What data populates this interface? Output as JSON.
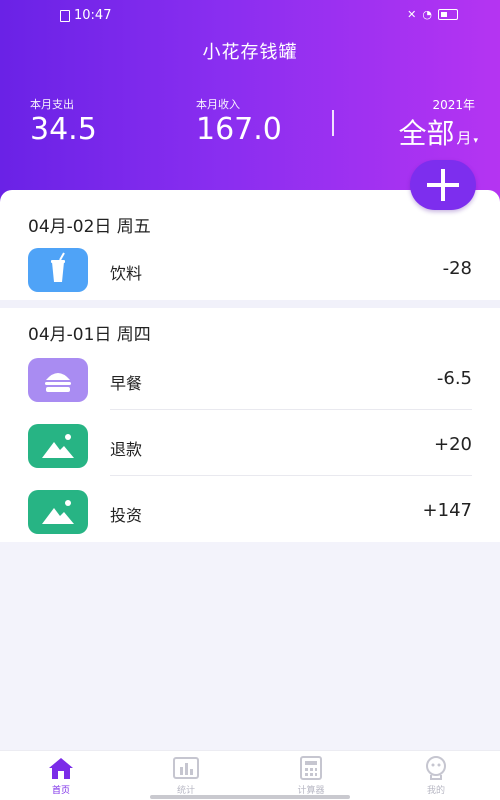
{
  "status_bar": {
    "time": "10:47"
  },
  "app": {
    "title": "小花存钱罐"
  },
  "summary": {
    "expense_label": "本月支出",
    "expense_value": "34.5",
    "income_label": "本月收入",
    "income_value": "167.0",
    "year": "2021年",
    "month_value": "全部",
    "month_suffix": "月",
    "caret": "▾"
  },
  "groups": [
    {
      "date": "04月-02日 周五",
      "transactions": [
        {
          "name": "饮料",
          "amount": "-28",
          "icon": "drink-icon"
        }
      ]
    },
    {
      "date": "04月-01日 周四",
      "transactions": [
        {
          "name": "早餐",
          "amount": "-6.5",
          "icon": "burger-icon"
        },
        {
          "name": "退款",
          "amount": "+20",
          "icon": "mountain-image-icon"
        },
        {
          "name": "投资",
          "amount": "+147",
          "icon": "mountain-image-icon"
        }
      ]
    }
  ],
  "tabs": [
    {
      "label": "首页",
      "icon": "home-icon",
      "active": true
    },
    {
      "label": "统计",
      "icon": "chart-icon",
      "active": false
    },
    {
      "label": "计算器",
      "icon": "calculator-icon",
      "active": false
    },
    {
      "label": "我的",
      "icon": "profile-icon",
      "active": false
    }
  ],
  "colors": {
    "accent": "#7b2ce8",
    "drink_icon": "#4fa3f7",
    "burger_icon": "#a98cf2",
    "image_icon": "#27b484"
  }
}
